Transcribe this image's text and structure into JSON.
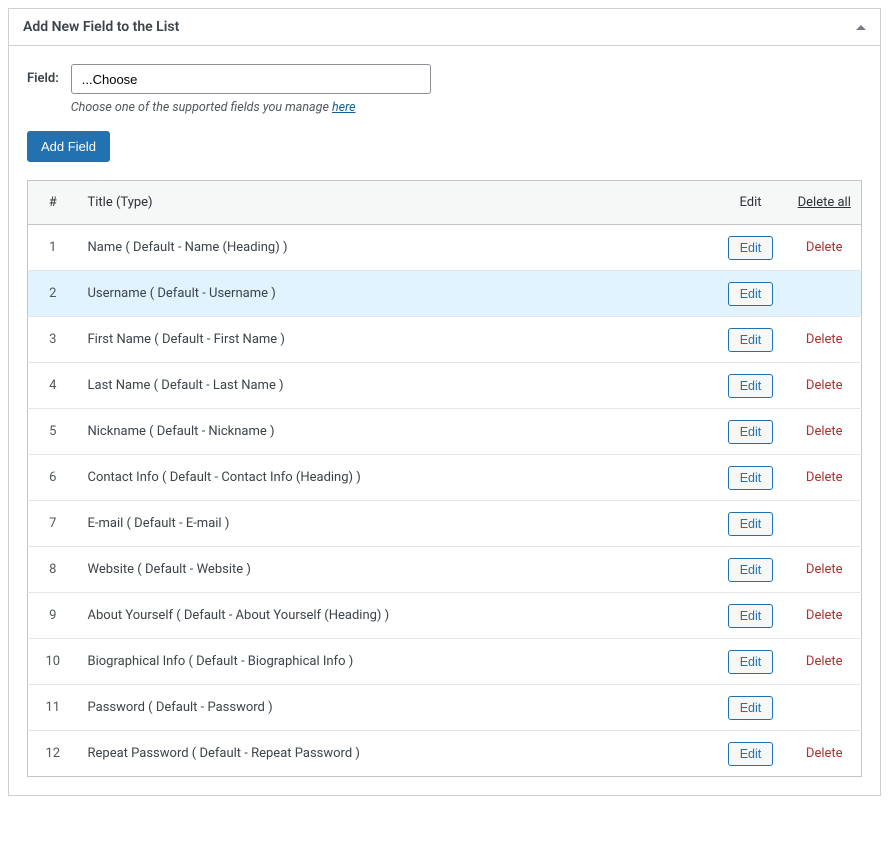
{
  "panel": {
    "title": "Add New Field to the List"
  },
  "form": {
    "field_label": "Field:",
    "select_placeholder": "...Choose",
    "hint_text_before": "Choose one of the supported fields you manage ",
    "hint_link": "here",
    "add_button": "Add Field"
  },
  "table": {
    "headers": {
      "num": "#",
      "title": "Title (Type)",
      "edit": "Edit",
      "delete_all": "Delete all"
    },
    "edit_label": "Edit",
    "delete_label": "Delete",
    "rows": [
      {
        "n": "1",
        "title": "Name ( Default - Name (Heading) )",
        "highlight": false,
        "deletable": true
      },
      {
        "n": "2",
        "title": "Username ( Default - Username )",
        "highlight": true,
        "deletable": false
      },
      {
        "n": "3",
        "title": "First Name ( Default - First Name )",
        "highlight": false,
        "deletable": true
      },
      {
        "n": "4",
        "title": "Last Name ( Default - Last Name )",
        "highlight": false,
        "deletable": true
      },
      {
        "n": "5",
        "title": "Nickname ( Default - Nickname )",
        "highlight": false,
        "deletable": true
      },
      {
        "n": "6",
        "title": "Contact Info ( Default - Contact Info (Heading) )",
        "highlight": false,
        "deletable": true
      },
      {
        "n": "7",
        "title": "E-mail ( Default - E-mail )",
        "highlight": false,
        "deletable": false
      },
      {
        "n": "8",
        "title": "Website ( Default - Website )",
        "highlight": false,
        "deletable": true
      },
      {
        "n": "9",
        "title": "About Yourself ( Default - About Yourself (Heading) )",
        "highlight": false,
        "deletable": true
      },
      {
        "n": "10",
        "title": "Biographical Info ( Default - Biographical Info )",
        "highlight": false,
        "deletable": true
      },
      {
        "n": "11",
        "title": "Password ( Default - Password )",
        "highlight": false,
        "deletable": false
      },
      {
        "n": "12",
        "title": "Repeat Password ( Default - Repeat Password )",
        "highlight": false,
        "deletable": true
      }
    ]
  }
}
